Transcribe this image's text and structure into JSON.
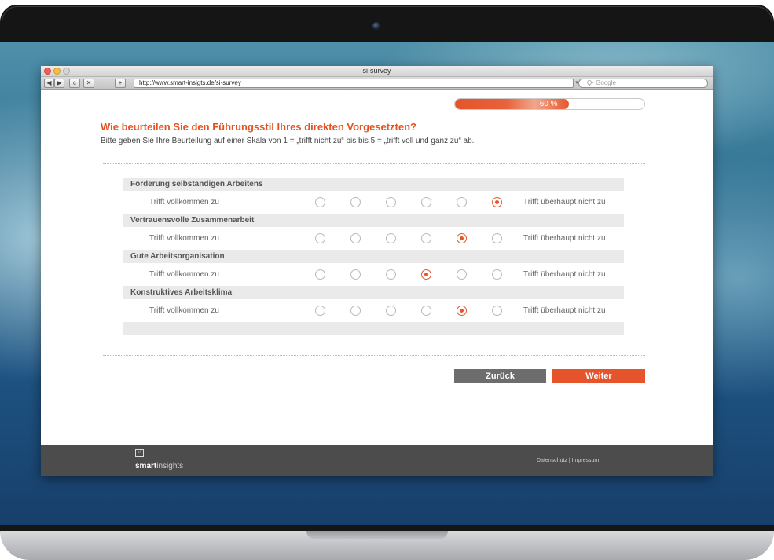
{
  "window": {
    "title": "si-survey",
    "url": "http://www.smart-insigts.de/si-survey",
    "search_placeholder": "Q- Google"
  },
  "toolbar": {
    "back_icon": "◀",
    "forward_icon": "▶",
    "reload_icon": "c",
    "bookmark_icon": "✕",
    "add_tab_icon": "+"
  },
  "progress": {
    "label": "60 %",
    "fraction": 0.6
  },
  "question": {
    "title": "Wie beurteilen Sie den Führungsstil Ihres direkten Vorgesetzten?",
    "instruction": "Bitte geben Sie Ihre Beurteilung auf einer Skala von 1 = „trifft nicht zu“ bis bis 5 = „trifft voll und ganz zu“ ab."
  },
  "matrix": {
    "rows": [
      {
        "label": "Förderung selbständigen Arbeitens",
        "left": "Trifft vollkommen zu",
        "right": "Trifft überhaupt nicht zu",
        "selected": 6
      },
      {
        "label": "Vertrauensvolle Zusammenarbeit",
        "left": "Trifft vollkommen zu",
        "right": "Trifft überhaupt nicht zu",
        "selected": 5
      },
      {
        "label": "Gute Arbeitsorganisation",
        "left": "Trifft vollkommen zu",
        "right": "Trifft überhaupt nicht zu",
        "selected": 4
      },
      {
        "label": "Konstruktives Arbeitsklima",
        "left": "Trifft vollkommen zu",
        "right": "Trifft überhaupt nicht zu",
        "selected": 5
      }
    ],
    "option_count": 6
  },
  "buttons": {
    "back_label": "Zurück",
    "next_label": "Weiter"
  },
  "footer": {
    "logo_bold": "smart",
    "logo_light": "insights",
    "links": "Datenschutz | Impressum"
  },
  "colors": {
    "accent": "#e5542b",
    "back_button": "#6d6d6d",
    "footer_bg": "#4c4c4c"
  }
}
